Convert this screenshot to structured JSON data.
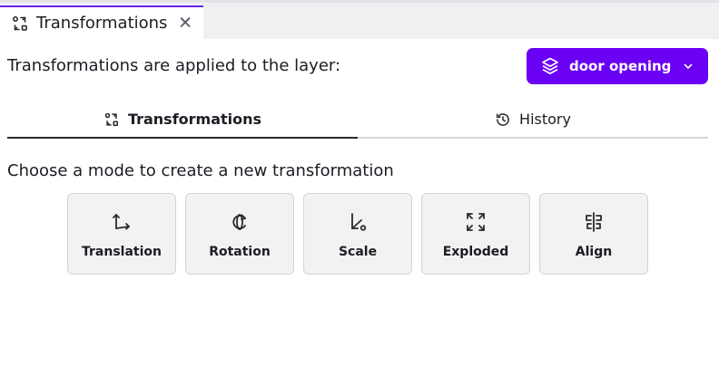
{
  "tab": {
    "title": "Transformations",
    "close": "✕",
    "icon": "transform-icon"
  },
  "header": {
    "label": "Transformations are applied to the layer:",
    "layer_button": {
      "label": "door opening",
      "icon": "layers-icon",
      "chevron": "chevron-down-icon",
      "color": "#6a00f4"
    }
  },
  "mode_tabs": [
    {
      "label": "Transformations",
      "icon": "transform-icon",
      "active": true
    },
    {
      "label": "History",
      "icon": "history-icon",
      "active": false
    }
  ],
  "prompt": "Choose a mode to create a new transformation",
  "modes": [
    {
      "label": "Translation",
      "icon": "translation-icon"
    },
    {
      "label": "Rotation",
      "icon": "rotation-icon"
    },
    {
      "label": "Scale",
      "icon": "scale-icon"
    },
    {
      "label": "Exploded",
      "icon": "exploded-icon"
    },
    {
      "label": "Align",
      "icon": "align-icon"
    }
  ],
  "colors": {
    "accent": "#6a00f4",
    "text": "#1c1c24",
    "card_bg": "#f2f2f3"
  }
}
